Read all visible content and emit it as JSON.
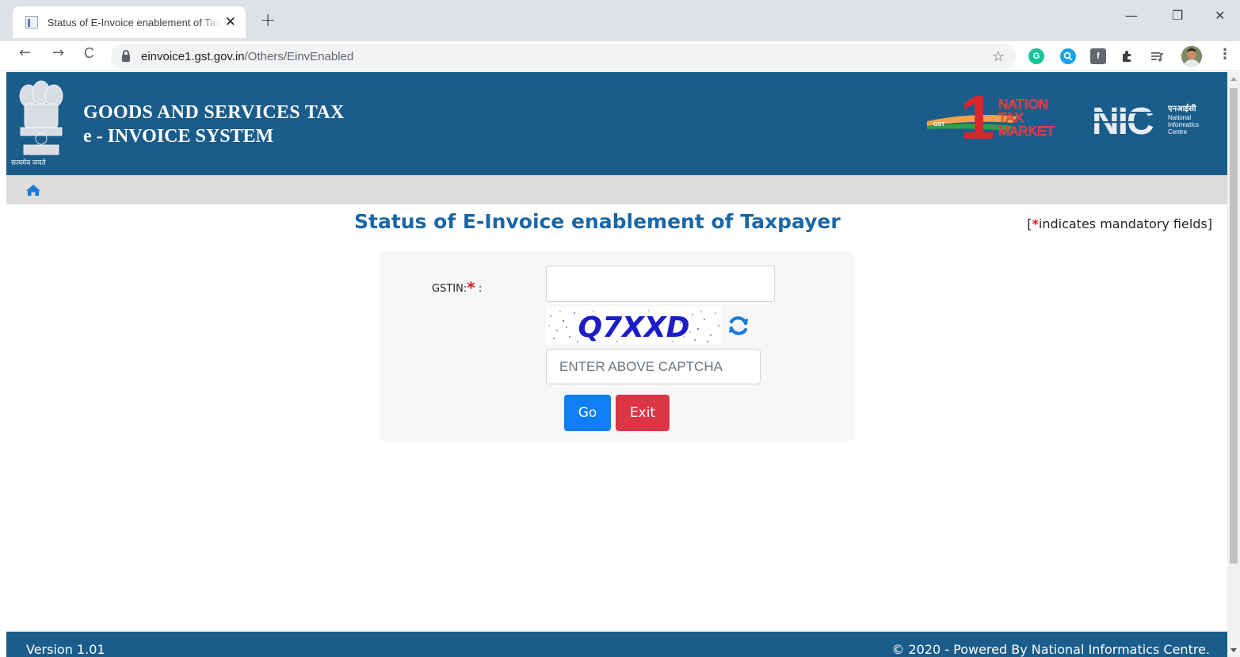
{
  "browser": {
    "tab_title": "Status of E-Invoice enablement of Taxpayer",
    "tab_close": "✕",
    "new_tab": "+",
    "url_host": "einvoice1.gst.gov.in",
    "url_path": "/Others/EinvEnabled",
    "window_controls": {
      "minimize": "—",
      "restore": "❐",
      "close": "✕"
    },
    "nav": {
      "back": "←",
      "forward": "→",
      "reload": "C"
    },
    "bookmark_star": "☆",
    "extensions": [
      {
        "icon": "grammarly-icon",
        "color": "#15c39a"
      },
      {
        "icon": "search-extension-icon",
        "color": "#1aa3e8"
      },
      {
        "icon": "facebook-icon",
        "color": "#606770"
      },
      {
        "icon": "puzzle-icon",
        "color": "#3c4043"
      },
      {
        "icon": "media-queue-icon",
        "color": "#5f6368"
      },
      {
        "icon": "profile-avatar",
        "color": "#b87a52"
      }
    ],
    "menu": "⋮"
  },
  "header": {
    "title_line1": "GOODS AND SERVICES TAX",
    "title_line2": "e - INVOICE SYSTEM",
    "emblem_caption": "सत्यमेव जयते",
    "background": "#1a5c8a",
    "logos": [
      {
        "name": "one-nation-one-tax-one-market-logo",
        "text": [
          "NATION",
          "TAX",
          "MARKET"
        ],
        "numeral": "1",
        "tag": "GST"
      },
      {
        "name": "nic-logo",
        "text": "NIC",
        "sub_hindi": "एनआईसी",
        "sub": [
          "National",
          "Informatics",
          "Centre"
        ]
      }
    ]
  },
  "page": {
    "title": "Status of E-Invoice enablement of Taxpayer",
    "mandatory_open": "[",
    "mandatory_star": "*",
    "mandatory_text": "indicates mandatory fields]",
    "accent": "#1a67a7"
  },
  "form": {
    "gstin_label": "GSTIN:",
    "gstin_required": "*",
    "gstin_colon": " :",
    "gstin_value": "",
    "captcha_text": "Q7XXD",
    "captcha_placeholder": "ENTER ABOVE CAPTCHA",
    "go_label": "Go",
    "exit_label": "Exit",
    "go_color": "#0f7ff5",
    "exit_color": "#dc3545"
  },
  "footer": {
    "version": "Version 1.01",
    "copyright": "© 2020 - Powered By National Informatics Centre."
  }
}
